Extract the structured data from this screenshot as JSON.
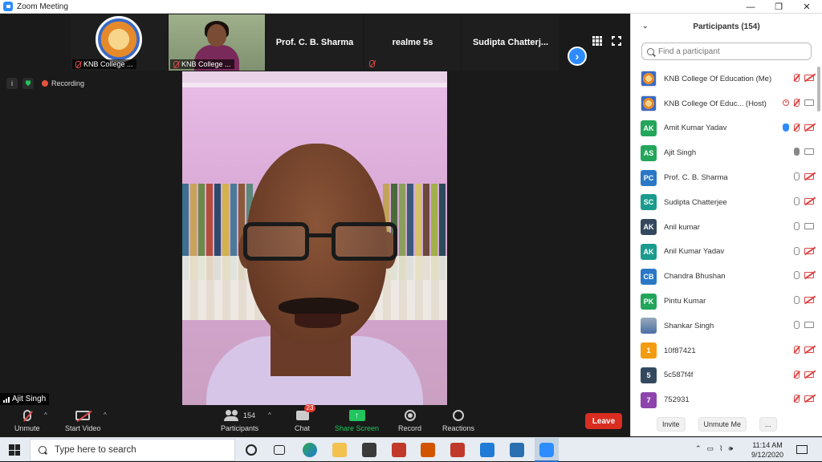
{
  "window": {
    "title": "Zoom Meeting",
    "min_glyph": "—",
    "max_glyph": "❐",
    "close_glyph": "✕"
  },
  "thumbnails": [
    {
      "type": "logo",
      "tag": "KNB College ..."
    },
    {
      "type": "video",
      "tag": "KNB College ..."
    },
    {
      "type": "name",
      "name": "Prof. C. B. Sharma"
    },
    {
      "type": "name",
      "name": "realme 5s"
    },
    {
      "type": "name",
      "name": "Sudipta  Chatterj..."
    }
  ],
  "status": {
    "recording_label": "Recording"
  },
  "speaker": {
    "name": "Ajit Singh"
  },
  "toolbar": {
    "unmute": "Unmute",
    "start_video": "Start Video",
    "participants": "Participants",
    "participants_count": "154",
    "chat": "Chat",
    "chat_badge": "23",
    "share_screen": "Share Screen",
    "record": "Record",
    "reactions": "Reactions",
    "leave": "Leave"
  },
  "panel": {
    "title": "Participants (154)",
    "search_placeholder": "Find a participant",
    "invite": "Invite",
    "unmute_me": "Unmute Me",
    "more": "..."
  },
  "participants": [
    {
      "initials": "",
      "avatar": "logo",
      "color": "",
      "name": "KNB College Of Education (Me)",
      "icons": [
        "mic-off",
        "cam-off"
      ]
    },
    {
      "initials": "",
      "avatar": "logo",
      "color": "",
      "name": "KNB College Of Educ... (Host)",
      "icons": [
        "rec",
        "mic-off",
        "cam"
      ]
    },
    {
      "initials": "AK",
      "avatar": "initials",
      "color": "#23a55a",
      "name": "Amit Kumar Yadav",
      "icons": [
        "hand",
        "mic-off",
        "cam-off"
      ]
    },
    {
      "initials": "AS",
      "avatar": "initials",
      "color": "#23a55a",
      "name": "Ajit Singh",
      "icons": [
        "mic-act",
        "cam"
      ]
    },
    {
      "initials": "PC",
      "avatar": "initials",
      "color": "#2a78c6",
      "name": "Prof. C. B. Sharma",
      "icons": [
        "mic",
        "cam-off"
      ]
    },
    {
      "initials": "SC",
      "avatar": "initials",
      "color": "#1a9b8d",
      "name": "Sudipta Chatterjee",
      "icons": [
        "mic",
        "cam-off"
      ]
    },
    {
      "initials": "AK",
      "avatar": "initials",
      "color": "#34495e",
      "name": "Anil kumar",
      "icons": [
        "mic",
        "cam"
      ]
    },
    {
      "initials": "AK",
      "avatar": "initials",
      "color": "#1a9b8d",
      "name": "Anil Kumar Yadav",
      "icons": [
        "mic",
        "cam-off"
      ]
    },
    {
      "initials": "CB",
      "avatar": "initials",
      "color": "#2a78c6",
      "name": "Chandra Bhushan",
      "icons": [
        "mic",
        "cam-off"
      ]
    },
    {
      "initials": "PK",
      "avatar": "initials",
      "color": "#23a55a",
      "name": "Pintu Kumar",
      "icons": [
        "mic",
        "cam-off"
      ]
    },
    {
      "initials": "",
      "avatar": "photo",
      "color": "",
      "name": "Shankar Singh",
      "icons": [
        "mic",
        "cam"
      ]
    },
    {
      "initials": "1",
      "avatar": "initials",
      "color": "#f39c12",
      "name": "10f87421",
      "icons": [
        "mic-off",
        "cam-off"
      ]
    },
    {
      "initials": "5",
      "avatar": "initials",
      "color": "#34495e",
      "name": "5c587f4f",
      "icons": [
        "mic-off",
        "cam-off"
      ]
    },
    {
      "initials": "7",
      "avatar": "initials",
      "color": "#8e44ad",
      "name": "752931",
      "icons": [
        "mic-off",
        "cam-off"
      ]
    }
  ],
  "taskbar": {
    "search_placeholder": "Type here to search",
    "time": "11:14 AM",
    "date": "9/12/2020"
  },
  "colors": {
    "accent": "#2d8cff",
    "leave": "#d92d20",
    "share": "#22c55e"
  }
}
